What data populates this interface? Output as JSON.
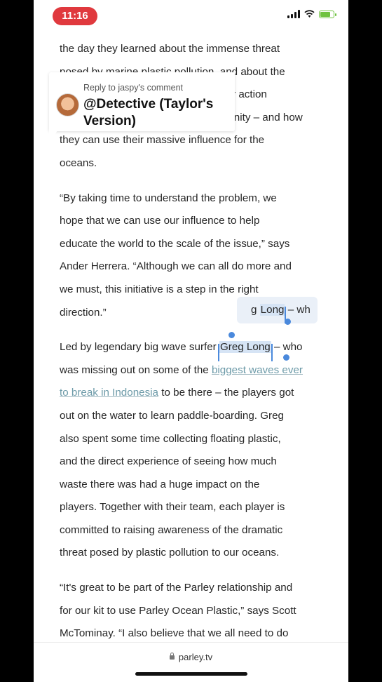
{
  "status_bar": {
    "time": "11:16",
    "icons": [
      "signal-icon",
      "wifi-icon",
      "battery-charging-icon"
    ]
  },
  "reply_popup": {
    "label": "Reply to jaspy's comment",
    "name": "@Detective (Taylor's Version)",
    "avatar_icon": "avatar"
  },
  "article": {
    "p1": {
      "l1": "the day they learned about the immense threat",
      "l2": "posed by marine plastic pollution, and about the",
      "l3": "greater action",
      "l4": "community – and how",
      "l5": "they can use their massive influence for the",
      "l6": "oceans."
    },
    "p2": {
      "l1": "“By taking time to understand the problem, we",
      "l2": "hope that we can use our influence to help",
      "l3": "educate the world to the scale of the issue,” says",
      "l4": "Ander Herrera. “Although we can all do more and",
      "l5": "we must, this initiative is a step in the right",
      "l6": "direction.”"
    },
    "p3": {
      "l1_before": "Led by legendary big wave surfer ",
      "l1_sel": "Greg Long",
      "l1_after": " – who",
      "l2_before": "was missing out on some of the ",
      "l2_link": "biggest waves ever",
      "l3_link": "to break in Indonesia",
      "l3_after": " to be there –  the players got",
      "l4": "out on the water to learn paddle-boarding. Greg",
      "l5": "also spent some time  collecting floating plastic,",
      "l6": "and the direct experience of seeing how much",
      "l7": "waste there was had a huge impact on the",
      "l8": "players. Together with their team, each player is",
      "l9": "committed to raising awareness of the dramatic",
      "l10": "threat posed by plastic pollution to our oceans."
    },
    "p4": {
      "l1": "“It's great to be part of the Parley relationship and",
      "l2": "for our kit to use Parley Ocean Plastic,” says Scott",
      "l3": "McTominay. “I also believe that we all need to do"
    }
  },
  "loupe": {
    "before": "g ",
    "sel": "Long",
    "after": " – wh"
  },
  "url_bar": {
    "url": "parley.tv",
    "lock_icon": "lock-icon"
  },
  "colors": {
    "time_pill": "#e0393e",
    "selection": "#d6e4f5",
    "selection_handle": "#4a89dc",
    "link": "#6c9aa8",
    "battery": "#6fc240"
  }
}
